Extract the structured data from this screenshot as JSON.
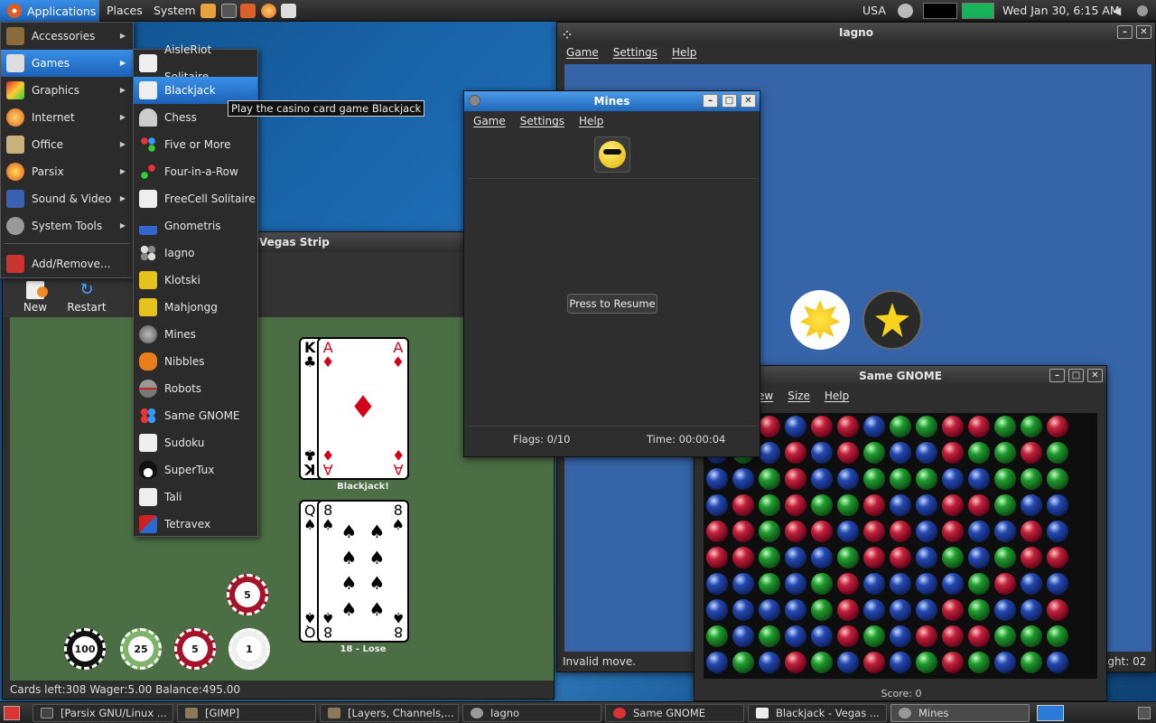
{
  "top_panel": {
    "applications": "Applications",
    "places": "Places",
    "system": "System",
    "keyboard_layout": "USA",
    "clock": "Wed Jan 30,  6:15 AM"
  },
  "apps_menu": [
    {
      "label": "Accessories"
    },
    {
      "label": "Games"
    },
    {
      "label": "Graphics"
    },
    {
      "label": "Internet"
    },
    {
      "label": "Office"
    },
    {
      "label": "Parsix"
    },
    {
      "label": "Sound & Video"
    },
    {
      "label": "System Tools"
    },
    {
      "label": "Add/Remove..."
    }
  ],
  "games_menu": [
    {
      "label": "AisleRiot Solitaire"
    },
    {
      "label": "Blackjack"
    },
    {
      "label": "Chess"
    },
    {
      "label": "Five or More"
    },
    {
      "label": "Four-in-a-Row"
    },
    {
      "label": "FreeCell Solitaire"
    },
    {
      "label": "Gnometris"
    },
    {
      "label": "Iagno"
    },
    {
      "label": "Klotski"
    },
    {
      "label": "Mahjongg"
    },
    {
      "label": "Mines"
    },
    {
      "label": "Nibbles"
    },
    {
      "label": "Robots"
    },
    {
      "label": "Same GNOME"
    },
    {
      "label": "Sudoku"
    },
    {
      "label": "SuperTux"
    },
    {
      "label": "Tali"
    },
    {
      "label": "Tetravex"
    }
  ],
  "tooltip": "Play the casino card game Blackjack",
  "blackjack": {
    "title_fragment": "Vegas Strip",
    "new": "New",
    "restart": "Restart",
    "dealer_cards": [
      {
        "rank": "K",
        "suit": "♣"
      },
      {
        "rank": "A",
        "suit": "♦"
      }
    ],
    "dealer_label": "Blackjack!",
    "player_cards": [
      {
        "rank": "Q",
        "suit": "♠"
      },
      {
        "rank": "8",
        "suit": "♠"
      }
    ],
    "player_label": "18 - Lose",
    "chips": [
      "100",
      "25",
      "5",
      "1",
      "5"
    ],
    "status": "Cards left:308  Wager:5.00  Balance:495.00"
  },
  "iagno": {
    "title": "Iagno",
    "menu": [
      "Game",
      "Settings",
      "Help"
    ],
    "status": "Invalid move.",
    "status_right": "ight:  02"
  },
  "mines": {
    "title": "Mines",
    "menu": [
      "Game",
      "Settings",
      "Help"
    ],
    "resume": "Press to Resume",
    "flags": "Flags: 0/10",
    "time": "Time: 00:00:04"
  },
  "same_gnome": {
    "title": "Same GNOME",
    "menu": [
      "ew",
      "Size",
      "Help"
    ],
    "score": "Score: 0",
    "grid": [
      "xbrbrrbggrrggr",
      "bgbrbrgbbrggrg",
      "bbgrbbgggbbggg",
      "brgrggrbbrrgbb",
      "rrgrrbrrbrbbrb",
      "rrgbbgrrbgbgrr",
      "bbgbgrbbbbgrbb",
      "bbbbgrbbbrgbbr",
      "gbgbbrgbrrrggg",
      "bgbrgbrbgrgbgb"
    ]
  },
  "taskbar": [
    {
      "label": "[Parsix GNU/Linux ..."
    },
    {
      "label": "[GIMP]"
    },
    {
      "label": "[Layers, Channels,..."
    },
    {
      "label": "Iagno"
    },
    {
      "label": "Same GNOME"
    },
    {
      "label": "Blackjack - Vegas ..."
    },
    {
      "label": "Mines"
    }
  ]
}
